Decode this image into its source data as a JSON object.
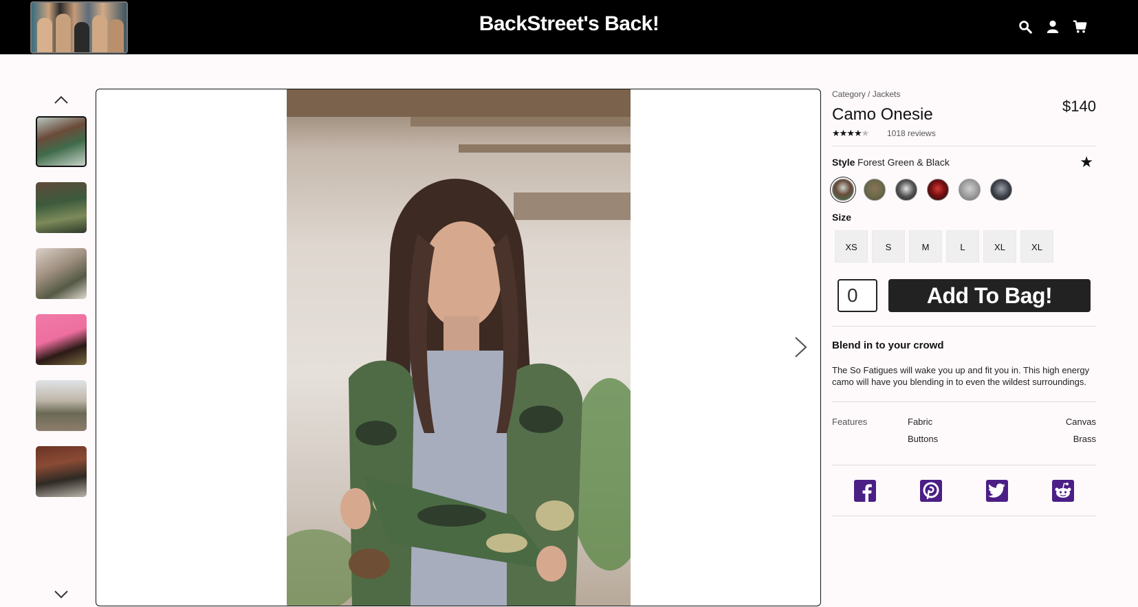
{
  "header": {
    "site_title": "BackStreet's Back!",
    "icons": [
      "search-icon",
      "user-icon",
      "cart-icon"
    ],
    "background": "#000000"
  },
  "product": {
    "breadcrumb": "Category / Jackets",
    "name": "Camo Onesie",
    "price": "$140",
    "rating": 3.5,
    "rating_max": 5,
    "reviews": "1018 reviews",
    "style_label": "Style",
    "style_value": "Forest Green & Black",
    "size_label": "Size",
    "sizes": [
      "XS",
      "S",
      "M",
      "L",
      "XL",
      "XL"
    ],
    "quantity": "0",
    "add_button": "Add To Bag!",
    "blurb_title": "Blend in to your crowd",
    "blurb": "The So Fatigues will wake you up and fit you in. This high energy camo will have you blending in to even the wildest surroundings.",
    "features_label": "Features",
    "features": [
      {
        "name": "Fabric",
        "value": "Canvas"
      },
      {
        "name": "Buttons",
        "value": "Brass"
      }
    ]
  },
  "social": [
    "facebook-icon",
    "pinterest-icon",
    "twitter-icon",
    "reddit-icon"
  ],
  "colors": {
    "accent_dark": "#222222",
    "social_purple": "#4b1f86"
  }
}
